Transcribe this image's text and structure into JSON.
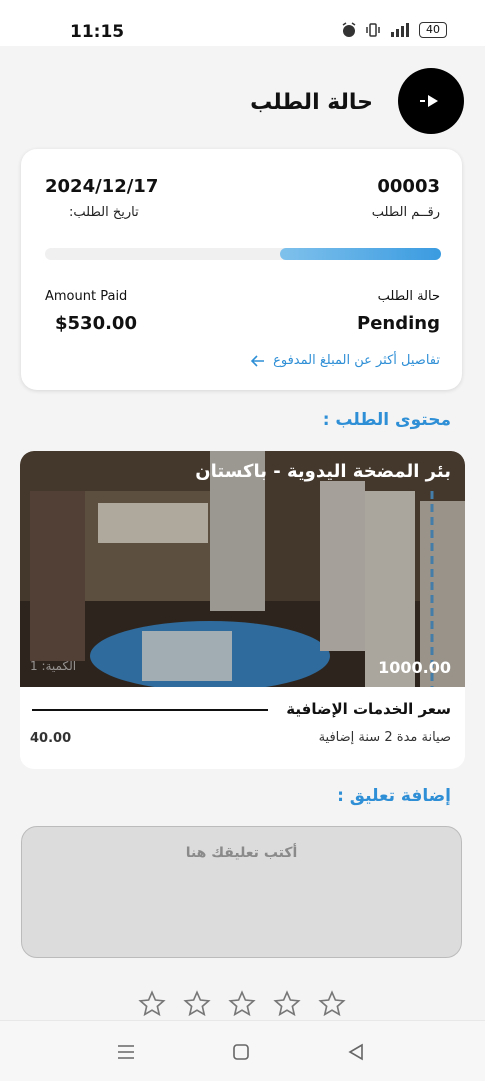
{
  "status_bar": {
    "time": "11:15",
    "battery": "40",
    "icons": [
      "alarm-icon",
      "vibrate-icon",
      "signal-icon",
      "battery-icon"
    ]
  },
  "header": {
    "title": "حالة الطلب",
    "back_icon": "back-play-icon"
  },
  "order": {
    "number": "00003",
    "number_label": "رقــم الطلب",
    "date": "2024/12/17",
    "date_label": "تاريخ الطلب:",
    "progress": 0.4,
    "status_label": "حالة الطلب",
    "status_value": "Pending",
    "amount_label": "Amount Paid",
    "amount_value": "$530.00",
    "details_link": "تفاصيل أكثر عن المبلغ المدفوع"
  },
  "content_section": {
    "title": "محتوى الطلب :"
  },
  "product": {
    "name": "بئر المضخة اليدوية - باكستان",
    "price": "1000.00",
    "quantity": "الكمية: 1",
    "services_title": "سعر الخدمات الإضافية",
    "service_name": "صيانة مدة 2 سنة إضافية",
    "service_price": "40.00"
  },
  "comment": {
    "title": "إضافة تعليق :",
    "placeholder": "أكتب تعليقك هنا"
  },
  "rating": {
    "max": 5,
    "value": 0
  },
  "colors": {
    "accent": "#2f8fd6",
    "background": "#f4f4f4",
    "card": "#ffffff"
  }
}
